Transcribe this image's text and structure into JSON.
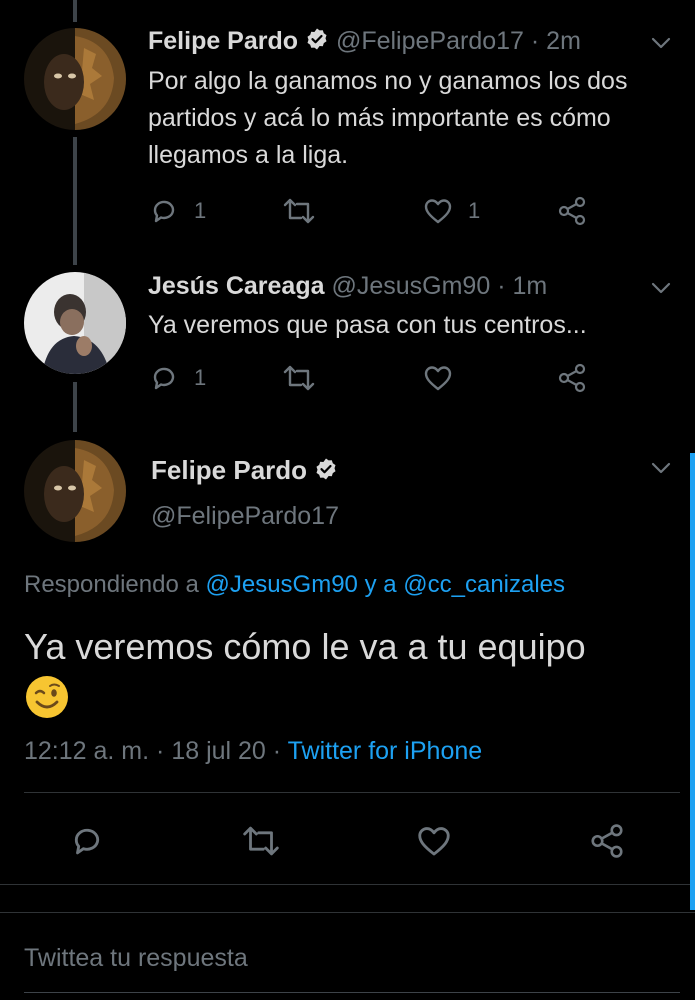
{
  "tweets": [
    {
      "name": "Felipe Pardo",
      "handle": "@FelipePardo17",
      "time": "· 2m",
      "text": "Por algo la ganamos no y ganamos los dos partidos y acá lo más importante es cómo llegamos a la liga.",
      "replies": "1",
      "likes": "1"
    },
    {
      "name": "Jesús Careaga",
      "handle": "@JesusGm90",
      "time": "· 1m",
      "text": "Ya veremos que pasa con tus centros...",
      "replies": "1",
      "likes": ""
    }
  ],
  "main": {
    "name": "Felipe Pardo",
    "handle": "@FelipePardo17",
    "replying_prefix": "Respondiendo a",
    "replying_user1": "@JesusGm90",
    "replying_and": "y a",
    "replying_user2": "@cc_canizales",
    "text": "Ya veremos cómo le va a tu equipo",
    "emoji": "😉",
    "time": "12:12 a. m.",
    "dot": "·",
    "date": "18 jul 20",
    "dot2": "·",
    "source": "Twitter for iPhone"
  },
  "reply_box": {
    "placeholder": "Twittea tu respuesta"
  },
  "colors": {
    "background": "#000000",
    "text": "#d9d9d9",
    "muted": "#6e767d",
    "accent": "#1da1f2"
  },
  "icons": [
    "verified-badge-icon",
    "chevron-down-icon",
    "reply-icon",
    "retweet-icon",
    "like-icon",
    "share-icon",
    "wink-emoji-icon"
  ]
}
